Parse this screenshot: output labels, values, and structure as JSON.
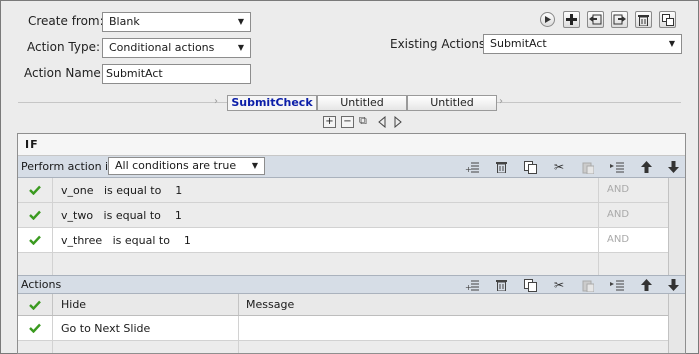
{
  "form": {
    "create_from_label": "Create from:",
    "create_from_value": "Blank",
    "action_type_label": "Action Type:",
    "action_type_value": "Conditional actions",
    "action_name_label": "Action Name:",
    "action_name_value": "SubmitAct",
    "existing_actions_label": "Existing Actions:",
    "existing_actions_value": "SubmitAct"
  },
  "tabs": [
    {
      "label": "SubmitCheck",
      "active": true
    },
    {
      "label": "Untitled",
      "active": false
    },
    {
      "label": "Untitled",
      "active": false
    }
  ],
  "if_panel": {
    "title": "IF",
    "perform_label": "Perform action if:",
    "condition_mode": "All conditions are true",
    "conditions": [
      {
        "text": "v_one   is equal to    1",
        "operator": "AND"
      },
      {
        "text": "v_two   is equal to    1",
        "operator": "AND"
      },
      {
        "text": "v_three   is equal to    1",
        "operator": "AND"
      }
    ]
  },
  "actions_panel": {
    "title": "Actions",
    "col_action": "Hide",
    "col_message": "Message",
    "rows": [
      {
        "action": "Go to Next Slide",
        "message": ""
      }
    ]
  },
  "icons": {
    "toolbar": [
      "play-icon",
      "add-icon",
      "import-icon",
      "export-icon",
      "delete-icon",
      "duplicate-icon"
    ],
    "grid_toolbar": [
      "insert-row-icon",
      "delete-icon",
      "copy-icon",
      "cut-icon",
      "paste-icon",
      "insert-below-icon",
      "move-up-icon",
      "move-down-icon"
    ]
  },
  "colors": {
    "active_tab": "#0b1ea8",
    "check_green": "#3a9a1f",
    "bar_blue": "#d6dde6"
  }
}
